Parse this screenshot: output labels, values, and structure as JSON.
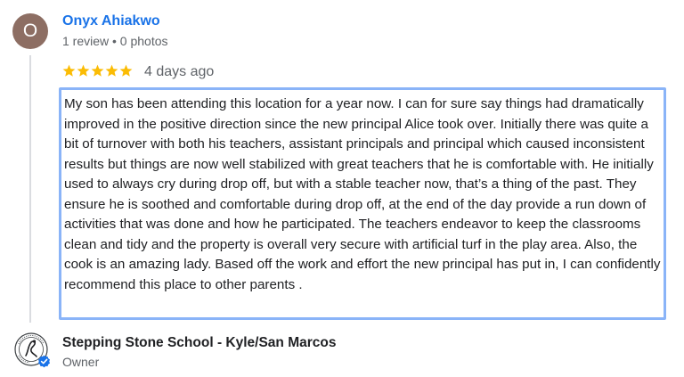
{
  "reviewer": {
    "avatar_letter": "O",
    "avatar_color": "#8d6e63",
    "name": "Onyx Ahiakwo",
    "meta": "1 review • 0 photos"
  },
  "review": {
    "rating": 5,
    "max_rating": 5,
    "star_color": "#fbbc04",
    "date": "4 days ago",
    "text": "My son has been attending this location for a year now. I can for sure say things had dramatically improved in the positive direction since the new principal Alice took over. Initially there was quite a bit of turnover with both his teachers, assistant principals and principal which caused inconsistent results but things are now well stabilized with great teachers that he is comfortable with. He initially used to always cry during drop off, but with a stable teacher now, that’s a thing of the past. They ensure he is soothed and comfortable during drop off, at the end of the day provide a run down of activities that was done and how he participated. The teachers endeavor to keep the classrooms clean and tidy and the property is overall very secure with artificial turf in the play area. Also, the cook is an amazing lady. Based off the work and effort the new principal has put in, I can confidently recommend this place to other parents ."
  },
  "owner_response": {
    "business_name": "Stepping Stone School - Kyle/San Marcos",
    "role": "Owner",
    "logo_icon": "stepping-stone-school-logo",
    "verified_icon": "verified-check-icon",
    "verified_color": "#1a73e8"
  },
  "accent_color": "#1a73e8",
  "selection_border_color": "#8ab4f8"
}
